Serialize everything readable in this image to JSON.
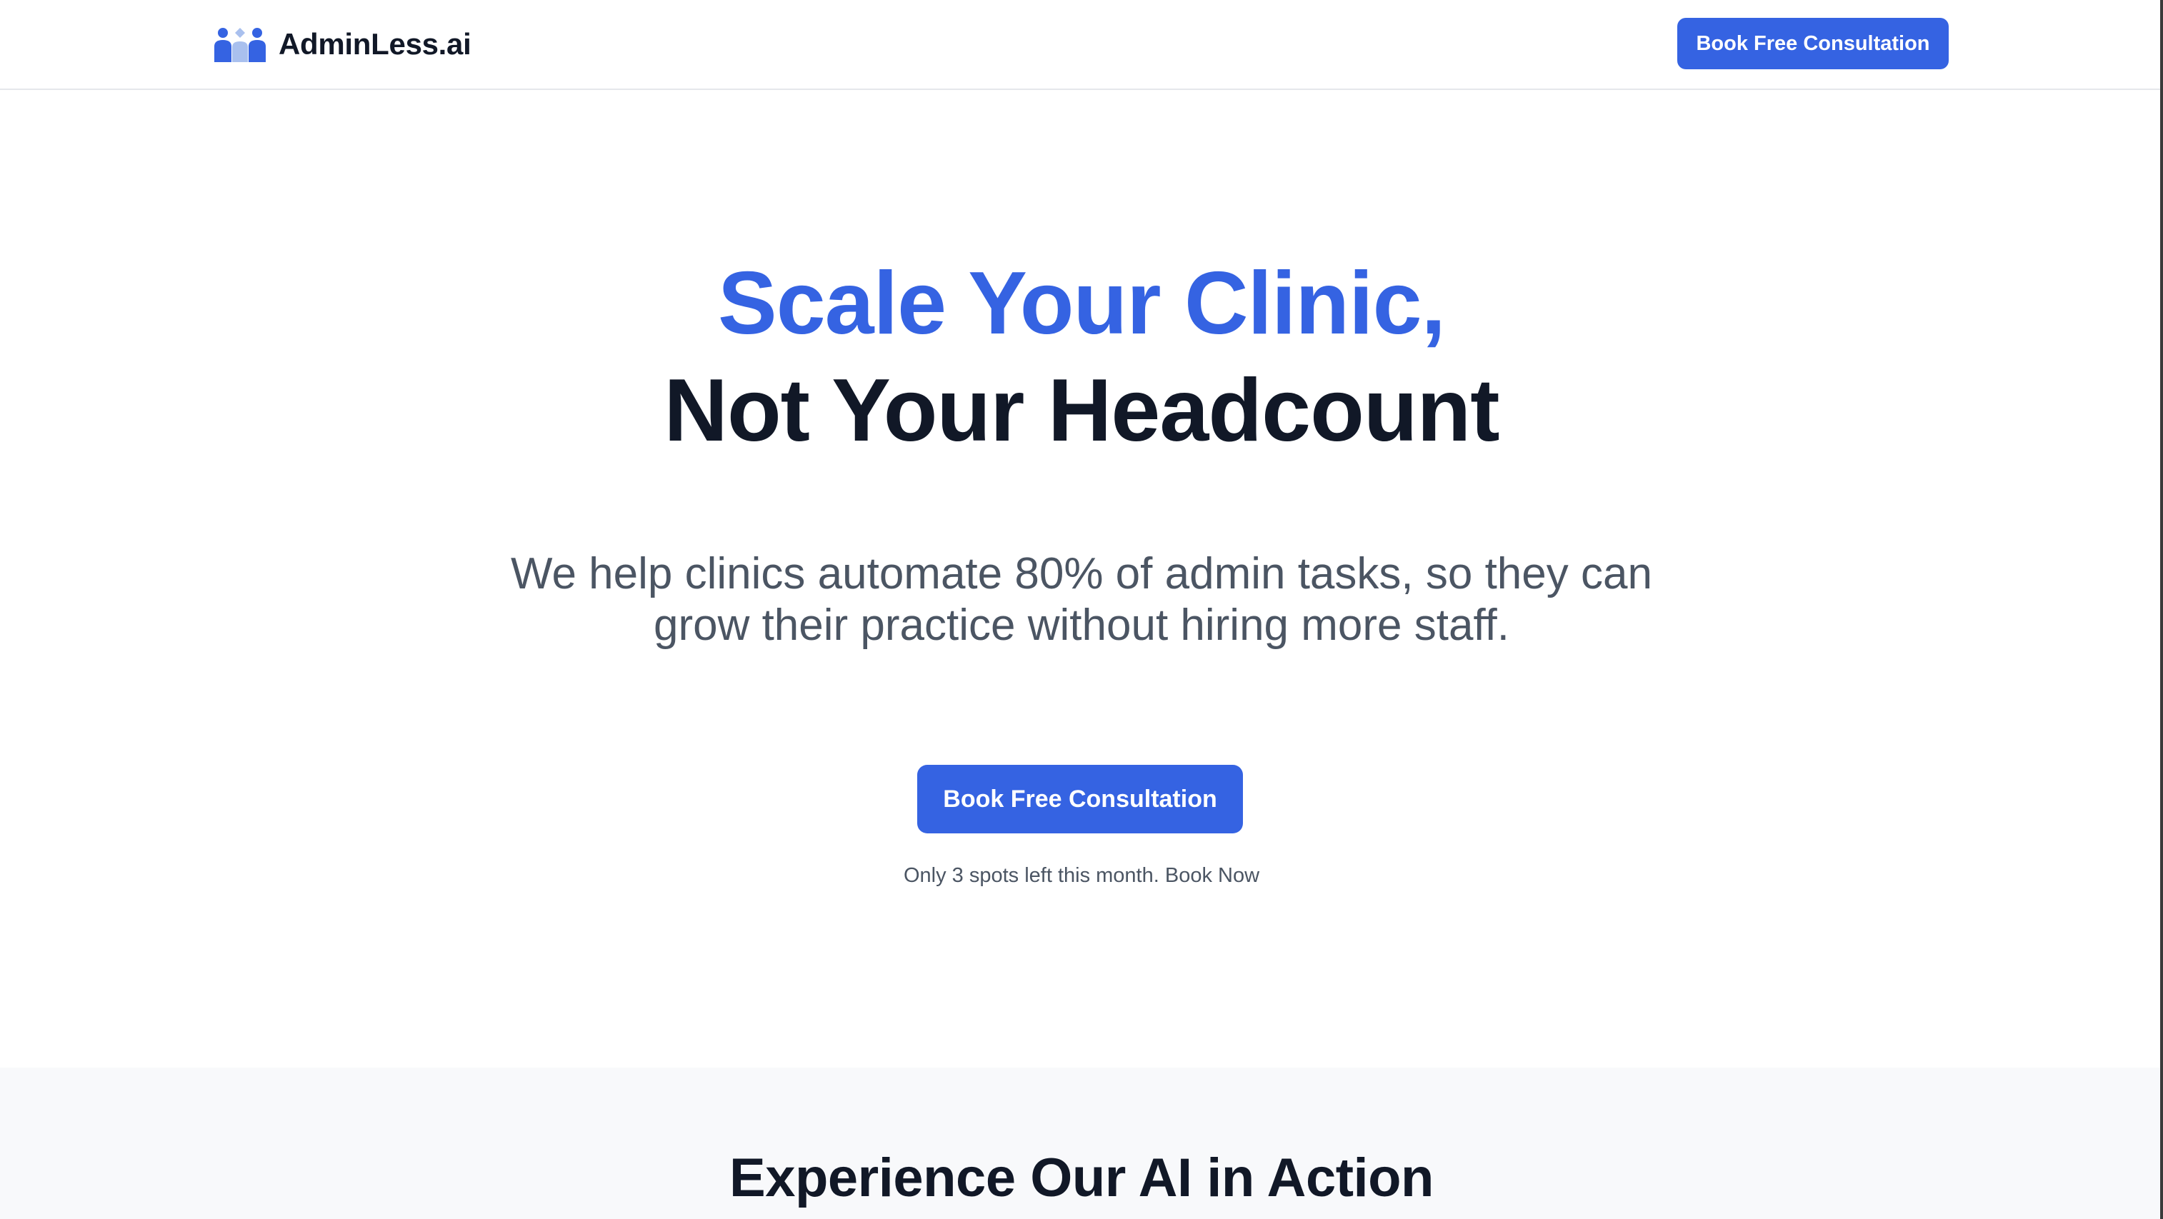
{
  "header": {
    "brand_name": "AdminLess.ai",
    "brand_icon": "people-group-icon",
    "cta_label": "Book Free Consultation"
  },
  "hero": {
    "headline_line1": "Scale Your Clinic,",
    "headline_line2": "Not Your Headcount",
    "subheadline": "We help clinics automate 80% of admin tasks, so they can grow their practice without hiring more staff.",
    "cta_label": "Book Free Consultation",
    "scarcity_text": "Only 3 spots left this month. Book Now"
  },
  "demo_section": {
    "title": "Experience Our AI in Action"
  },
  "colors": {
    "accent": "#3563e2",
    "heading": "#111827",
    "body_text": "#4b5563",
    "section_bg": "#f8f9fb",
    "border": "#e5e7eb",
    "icon_light": "#a9c0ee"
  }
}
